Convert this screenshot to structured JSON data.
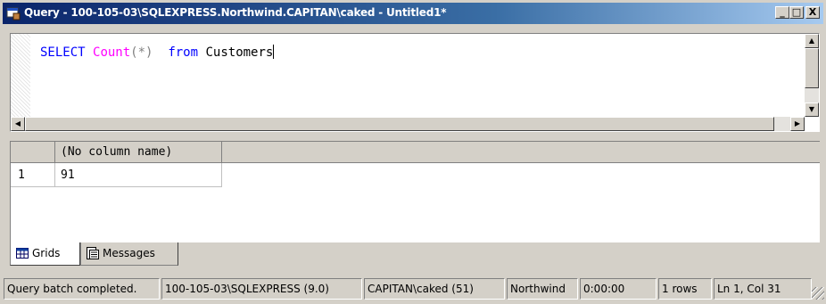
{
  "window": {
    "title": "Query - 100-105-03\\SQLEXPRESS.Northwind.CAPITAN\\caked - Untitled1*",
    "minimize": "_",
    "maximize": "□",
    "close": "X"
  },
  "editor": {
    "keyword_select": "SELECT",
    "func_count": "Count",
    "paren_star": "(*)",
    "keyword_from": "from",
    "table": "Customers"
  },
  "results": {
    "columns": [
      "(No column name)"
    ],
    "rows": [
      {
        "num": "1",
        "values": [
          "91"
        ]
      }
    ]
  },
  "tabs": {
    "grids": "Grids",
    "messages": "Messages"
  },
  "status": {
    "message": "Query batch completed.",
    "server": "100-105-03\\SQLEXPRESS (9.0)",
    "user": "CAPITAN\\caked (51)",
    "database": "Northwind",
    "elapsed": "0:00:00",
    "rows": "1 rows",
    "position": "Ln 1, Col 31"
  },
  "colors": {
    "keyword": "#0000ff",
    "function": "#ff00ff",
    "title_bar_start": "#0a246a"
  }
}
